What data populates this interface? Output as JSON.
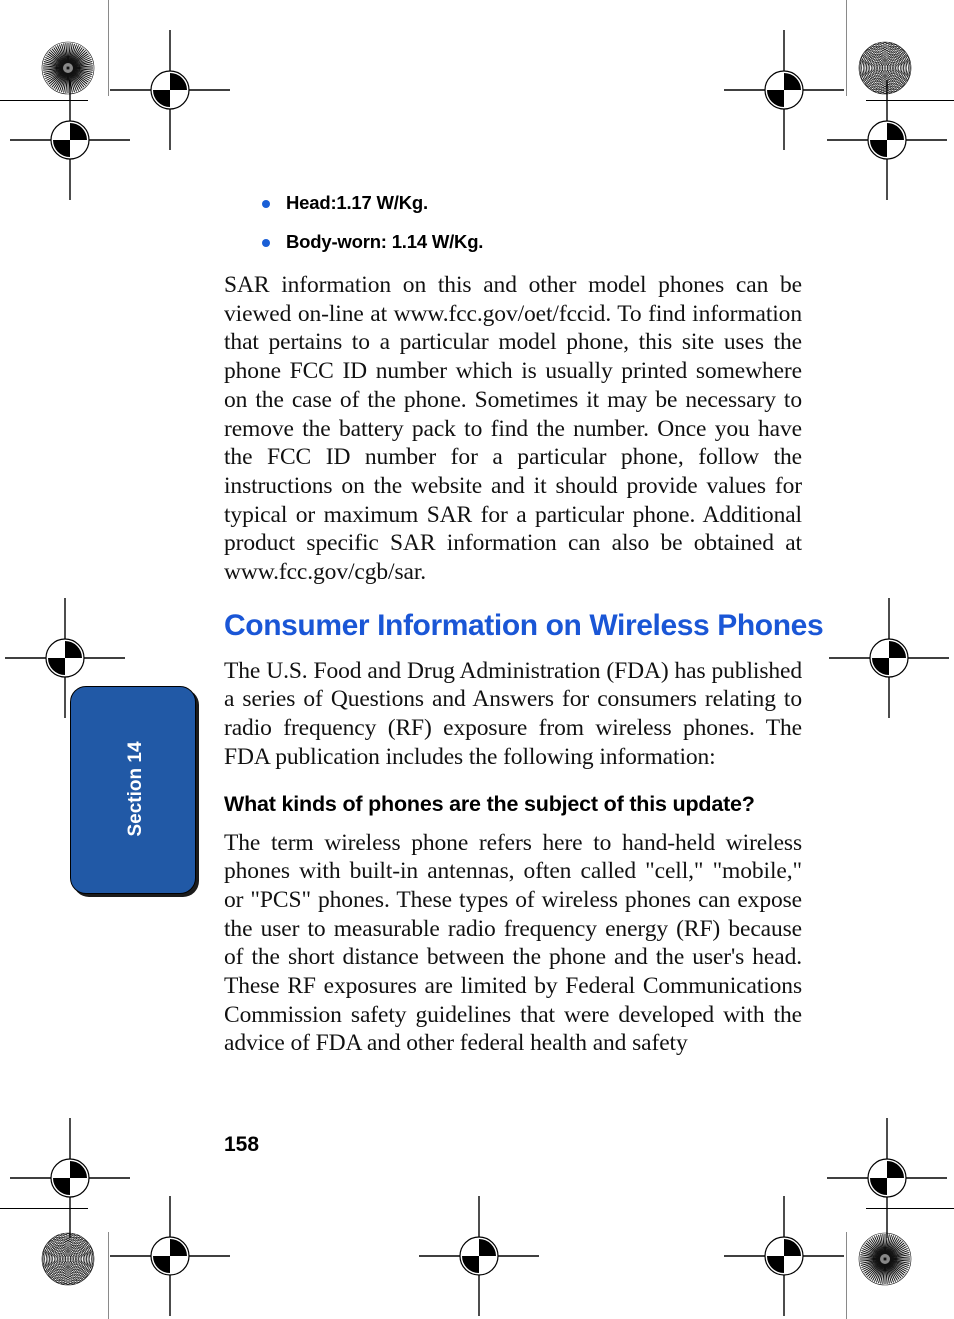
{
  "document": {
    "page_number": "158",
    "section_tab_label": "Section 14"
  },
  "sar_bullets": [
    {
      "label": "Head:1.17 W/Kg."
    },
    {
      "label": "Body-worn: 1.14 W/Kg."
    }
  ],
  "paragraphs": {
    "sar_info": "SAR information on this and other model phones can be viewed on-line at www.fcc.gov/oet/fccid.  To find information that pertains to a particular model phone, this site uses the phone FCC ID number which is usually printed somewhere on the case of the phone.  Sometimes it may be necessary to remove the battery pack to find the number.  Once you have the FCC ID number for a particular phone, follow the instructions on the website and it should provide values for typical or maximum SAR for a particular phone.  Additional product specific SAR information can also be obtained at www.fcc.gov/cgb/sar.",
    "fda_intro": "The U.S. Food and Drug Administration (FDA) has published a series of Questions and Answers  for consumers relating to radio frequency (RF) exposure from wireless phones.  The FDA publication includes the following information:",
    "phone_kinds": "The term wireless phone refers here to hand-held wireless phones with built-in antennas, often called \"cell,\" \"mobile,\" or \"PCS\" phones.  These types of wireless phones can expose the user to measurable radio frequency energy (RF) because of the short distance between the phone and the user's head.  These RF exposures are limited by Federal Communications Commission safety guidelines that were developed with the advice of FDA and other federal health and safety"
  },
  "headings": {
    "section": "Consumer Information on Wireless Phones",
    "question": "What kinds of phones are the subject of this update?"
  },
  "colors": {
    "heading_blue": "#1A56D6",
    "tab_blue": "#2159A6",
    "bullet_blue": "#1A5FD6",
    "text_black": "#000000",
    "trim_gray": "#8A8A8A"
  }
}
